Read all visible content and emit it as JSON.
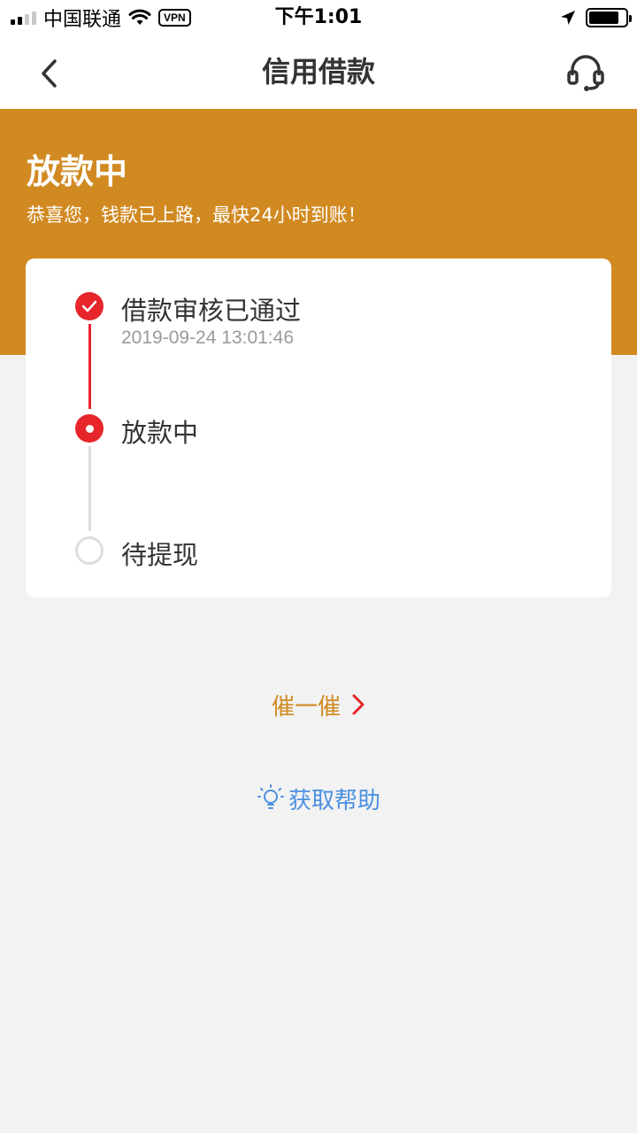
{
  "status_bar": {
    "carrier": "中国联通",
    "vpn": "VPN",
    "time": "下午1:01"
  },
  "nav": {
    "title": "信用借款",
    "back_icon": "chevron-left-icon",
    "service_icon": "headset-icon"
  },
  "banner": {
    "title": "放款中",
    "subtitle": "恭喜您，钱款已上路，最快24小时到账！"
  },
  "progress": {
    "steps": [
      {
        "label": "借款审核已通过",
        "time": "2019-09-24 13:01:46",
        "state": "done"
      },
      {
        "label": "放款中",
        "time": "",
        "state": "current"
      },
      {
        "label": "待提现",
        "time": "",
        "state": "pending"
      }
    ]
  },
  "actions": {
    "urge_label": "催一催",
    "help_label": "获取帮助"
  },
  "colors": {
    "accent_orange": "#d18a22",
    "step_red": "#e6262a",
    "help_blue": "#4a90e2",
    "background": "#f2f2f2"
  }
}
